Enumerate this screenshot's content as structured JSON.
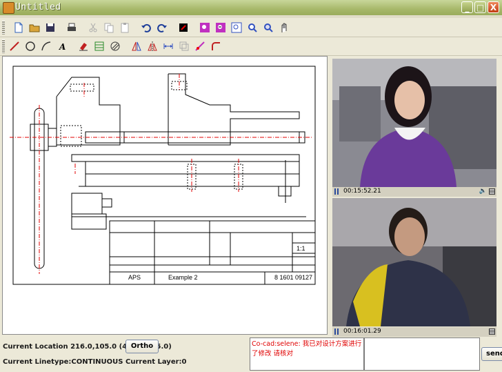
{
  "window": {
    "title": "Untitled"
  },
  "toolbar1": [
    {
      "name": "new-file-icon",
      "color": "#2c5fb8"
    },
    {
      "name": "open-folder-icon",
      "color": "#d9a53b"
    },
    {
      "name": "save-icon",
      "color": "#335"
    },
    {
      "name": "print-icon",
      "color": "#444"
    },
    {
      "name": "cut-icon",
      "color": "#aaa"
    },
    {
      "name": "copy-icon",
      "color": "#aaa"
    },
    {
      "name": "paste-icon",
      "color": "#aaa"
    },
    {
      "name": "undo-icon",
      "color": "#1f3f9a"
    },
    {
      "name": "redo-icon",
      "color": "#1f3f9a"
    },
    {
      "name": "color-icon",
      "color": "#000"
    },
    {
      "name": "zoom-in-icon",
      "color": "#c030c0"
    },
    {
      "name": "zoom-out-icon",
      "color": "#c030c0"
    },
    {
      "name": "zoom-window-icon",
      "color": "#3050c0"
    },
    {
      "name": "zoom-all-icon",
      "color": "#3050c0"
    },
    {
      "name": "zoom-extent-icon",
      "color": "#3050c0"
    },
    {
      "name": "pan-icon",
      "color": "#333"
    }
  ],
  "toolbar2": [
    {
      "name": "line-icon",
      "color": "#c02020"
    },
    {
      "name": "circle-icon",
      "color": "#333"
    },
    {
      "name": "arc-icon",
      "color": "#333"
    },
    {
      "name": "text-icon",
      "color": "#000"
    },
    {
      "name": "erase-icon",
      "color": "#c02020"
    },
    {
      "name": "layer-icon",
      "color": "#2a8a2a"
    },
    {
      "name": "hatch-icon",
      "color": "#333"
    },
    {
      "name": "mirror-icon",
      "color": "#c02020"
    },
    {
      "name": "mirror-v-icon",
      "color": "#c02020"
    },
    {
      "name": "dimension-icon",
      "color": "#3050c0"
    },
    {
      "name": "offset-icon",
      "color": "#aaa"
    },
    {
      "name": "trim-icon",
      "color": "#c030c0"
    },
    {
      "name": "fillet-icon",
      "color": "#c02020"
    }
  ],
  "drawing": {
    "title_block": {
      "company": "APS",
      "name": "Example 2",
      "number": "8 1601 09127",
      "scale": "1:1"
    }
  },
  "videos": [
    {
      "time": "00:15:52.21",
      "speaker": "🔈"
    },
    {
      "time": "00:16:01.29",
      "speaker": ""
    }
  ],
  "status": {
    "location": "Current Location 216.0,105.0 (464.0,225.0)",
    "ortho_label": "Ortho",
    "linetype": "Current Linetype:CONTINUOUS",
    "layer": "Current Layer:0"
  },
  "chat": {
    "message": "Co-cad:selene: 我已对设计方案进行了修改 请核对",
    "input_value": "",
    "send_label": "send"
  }
}
